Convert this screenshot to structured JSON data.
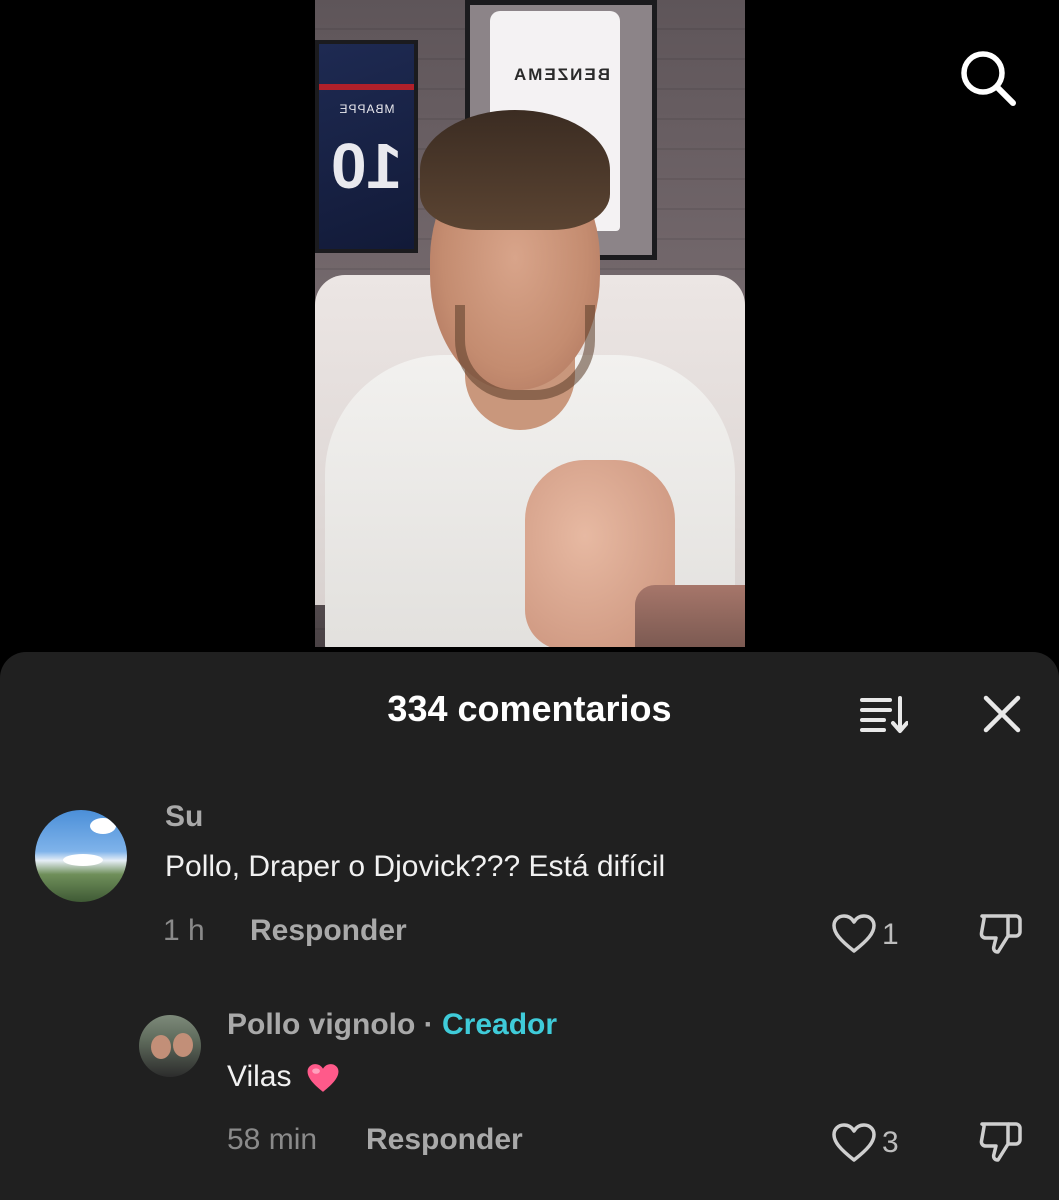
{
  "video": {
    "jersey_left_name": "MBAPPE",
    "jersey_left_number": "10",
    "jersey_right_name": "BENZEMA"
  },
  "header": {
    "search_icon": "search-icon"
  },
  "comments_panel": {
    "title": "334 comentarios",
    "sort_icon": "sort-icon",
    "close_icon": "close-icon",
    "comments": [
      {
        "username": "Su",
        "text": "Pollo, Draper o Djovick??? Está difícil",
        "time": "1 h",
        "reply_label": "Responder",
        "likes": "1"
      }
    ],
    "replies": [
      {
        "username": "Pollo vignolo",
        "separator": "·",
        "badge": "Creador",
        "text": "Vilas",
        "emoji_icon": "pink-heart-icon",
        "time": "58 min",
        "reply_label": "Responder",
        "likes": "3"
      }
    ]
  },
  "colors": {
    "sheet_bg": "#202020",
    "creator_accent": "#3fcbd9",
    "heart_emoji": "#ff5a8a"
  }
}
